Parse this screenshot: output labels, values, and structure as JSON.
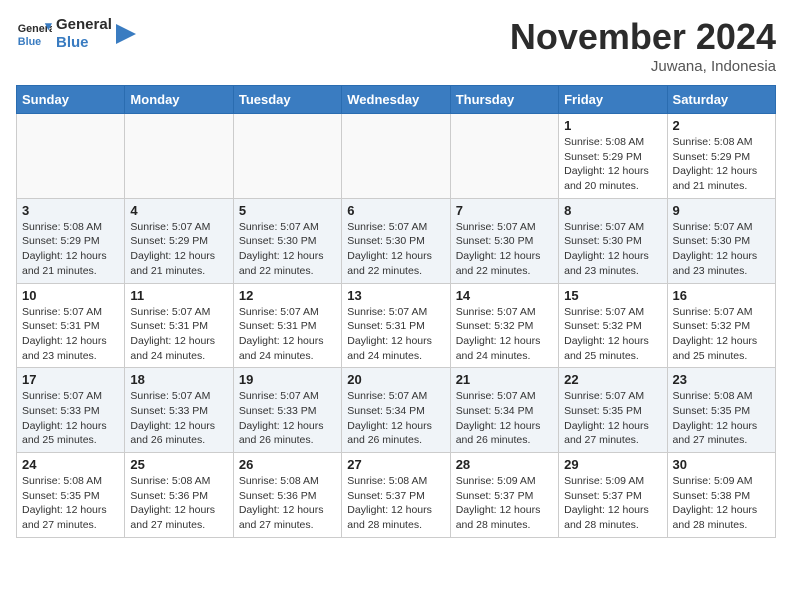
{
  "header": {
    "logo_line1": "General",
    "logo_line2": "Blue",
    "month": "November 2024",
    "location": "Juwana, Indonesia"
  },
  "days_of_week": [
    "Sunday",
    "Monday",
    "Tuesday",
    "Wednesday",
    "Thursday",
    "Friday",
    "Saturday"
  ],
  "weeks": [
    [
      {
        "day": "",
        "info": ""
      },
      {
        "day": "",
        "info": ""
      },
      {
        "day": "",
        "info": ""
      },
      {
        "day": "",
        "info": ""
      },
      {
        "day": "",
        "info": ""
      },
      {
        "day": "1",
        "info": "Sunrise: 5:08 AM\nSunset: 5:29 PM\nDaylight: 12 hours\nand 20 minutes."
      },
      {
        "day": "2",
        "info": "Sunrise: 5:08 AM\nSunset: 5:29 PM\nDaylight: 12 hours\nand 21 minutes."
      }
    ],
    [
      {
        "day": "3",
        "info": "Sunrise: 5:08 AM\nSunset: 5:29 PM\nDaylight: 12 hours\nand 21 minutes."
      },
      {
        "day": "4",
        "info": "Sunrise: 5:07 AM\nSunset: 5:29 PM\nDaylight: 12 hours\nand 21 minutes."
      },
      {
        "day": "5",
        "info": "Sunrise: 5:07 AM\nSunset: 5:30 PM\nDaylight: 12 hours\nand 22 minutes."
      },
      {
        "day": "6",
        "info": "Sunrise: 5:07 AM\nSunset: 5:30 PM\nDaylight: 12 hours\nand 22 minutes."
      },
      {
        "day": "7",
        "info": "Sunrise: 5:07 AM\nSunset: 5:30 PM\nDaylight: 12 hours\nand 22 minutes."
      },
      {
        "day": "8",
        "info": "Sunrise: 5:07 AM\nSunset: 5:30 PM\nDaylight: 12 hours\nand 23 minutes."
      },
      {
        "day": "9",
        "info": "Sunrise: 5:07 AM\nSunset: 5:30 PM\nDaylight: 12 hours\nand 23 minutes."
      }
    ],
    [
      {
        "day": "10",
        "info": "Sunrise: 5:07 AM\nSunset: 5:31 PM\nDaylight: 12 hours\nand 23 minutes."
      },
      {
        "day": "11",
        "info": "Sunrise: 5:07 AM\nSunset: 5:31 PM\nDaylight: 12 hours\nand 24 minutes."
      },
      {
        "day": "12",
        "info": "Sunrise: 5:07 AM\nSunset: 5:31 PM\nDaylight: 12 hours\nand 24 minutes."
      },
      {
        "day": "13",
        "info": "Sunrise: 5:07 AM\nSunset: 5:31 PM\nDaylight: 12 hours\nand 24 minutes."
      },
      {
        "day": "14",
        "info": "Sunrise: 5:07 AM\nSunset: 5:32 PM\nDaylight: 12 hours\nand 24 minutes."
      },
      {
        "day": "15",
        "info": "Sunrise: 5:07 AM\nSunset: 5:32 PM\nDaylight: 12 hours\nand 25 minutes."
      },
      {
        "day": "16",
        "info": "Sunrise: 5:07 AM\nSunset: 5:32 PM\nDaylight: 12 hours\nand 25 minutes."
      }
    ],
    [
      {
        "day": "17",
        "info": "Sunrise: 5:07 AM\nSunset: 5:33 PM\nDaylight: 12 hours\nand 25 minutes."
      },
      {
        "day": "18",
        "info": "Sunrise: 5:07 AM\nSunset: 5:33 PM\nDaylight: 12 hours\nand 26 minutes."
      },
      {
        "day": "19",
        "info": "Sunrise: 5:07 AM\nSunset: 5:33 PM\nDaylight: 12 hours\nand 26 minutes."
      },
      {
        "day": "20",
        "info": "Sunrise: 5:07 AM\nSunset: 5:34 PM\nDaylight: 12 hours\nand 26 minutes."
      },
      {
        "day": "21",
        "info": "Sunrise: 5:07 AM\nSunset: 5:34 PM\nDaylight: 12 hours\nand 26 minutes."
      },
      {
        "day": "22",
        "info": "Sunrise: 5:07 AM\nSunset: 5:35 PM\nDaylight: 12 hours\nand 27 minutes."
      },
      {
        "day": "23",
        "info": "Sunrise: 5:08 AM\nSunset: 5:35 PM\nDaylight: 12 hours\nand 27 minutes."
      }
    ],
    [
      {
        "day": "24",
        "info": "Sunrise: 5:08 AM\nSunset: 5:35 PM\nDaylight: 12 hours\nand 27 minutes."
      },
      {
        "day": "25",
        "info": "Sunrise: 5:08 AM\nSunset: 5:36 PM\nDaylight: 12 hours\nand 27 minutes."
      },
      {
        "day": "26",
        "info": "Sunrise: 5:08 AM\nSunset: 5:36 PM\nDaylight: 12 hours\nand 27 minutes."
      },
      {
        "day": "27",
        "info": "Sunrise: 5:08 AM\nSunset: 5:37 PM\nDaylight: 12 hours\nand 28 minutes."
      },
      {
        "day": "28",
        "info": "Sunrise: 5:09 AM\nSunset: 5:37 PM\nDaylight: 12 hours\nand 28 minutes."
      },
      {
        "day": "29",
        "info": "Sunrise: 5:09 AM\nSunset: 5:37 PM\nDaylight: 12 hours\nand 28 minutes."
      },
      {
        "day": "30",
        "info": "Sunrise: 5:09 AM\nSunset: 5:38 PM\nDaylight: 12 hours\nand 28 minutes."
      }
    ]
  ]
}
